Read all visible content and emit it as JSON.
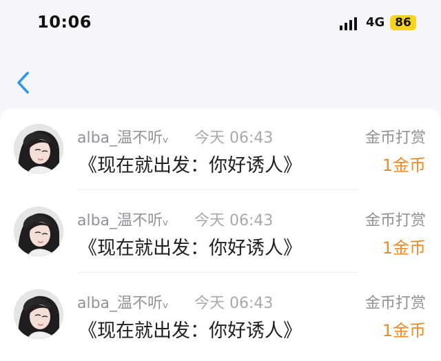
{
  "status_bar": {
    "time": "10:06",
    "network": "4G",
    "battery": "86",
    "battery_color": "#f6d31c"
  },
  "nav": {
    "back_icon": "chevron-left-icon",
    "accent_color": "#2f96e8"
  },
  "rows": [
    {
      "username": "alba_温不听ᵥ",
      "time": "今天 06:43",
      "message": "《现在就出发：你好诱人》",
      "reward_label": "金币打赏",
      "reward_amount": "1金币"
    },
    {
      "username": "alba_温不听ᵥ",
      "time": "今天 06:43",
      "message": "《现在就出发：你好诱人》",
      "reward_label": "金币打赏",
      "reward_amount": "1金币"
    },
    {
      "username": "alba_温不听ᵥ",
      "time": "今天 06:43",
      "message": "《现在就出发：你好诱人》",
      "reward_label": "金币打赏",
      "reward_amount": "1金币"
    }
  ],
  "colors": {
    "reward_amount": "#f08a23",
    "secondary_text": "#8f9399",
    "primary_text": "#1d1f22"
  }
}
